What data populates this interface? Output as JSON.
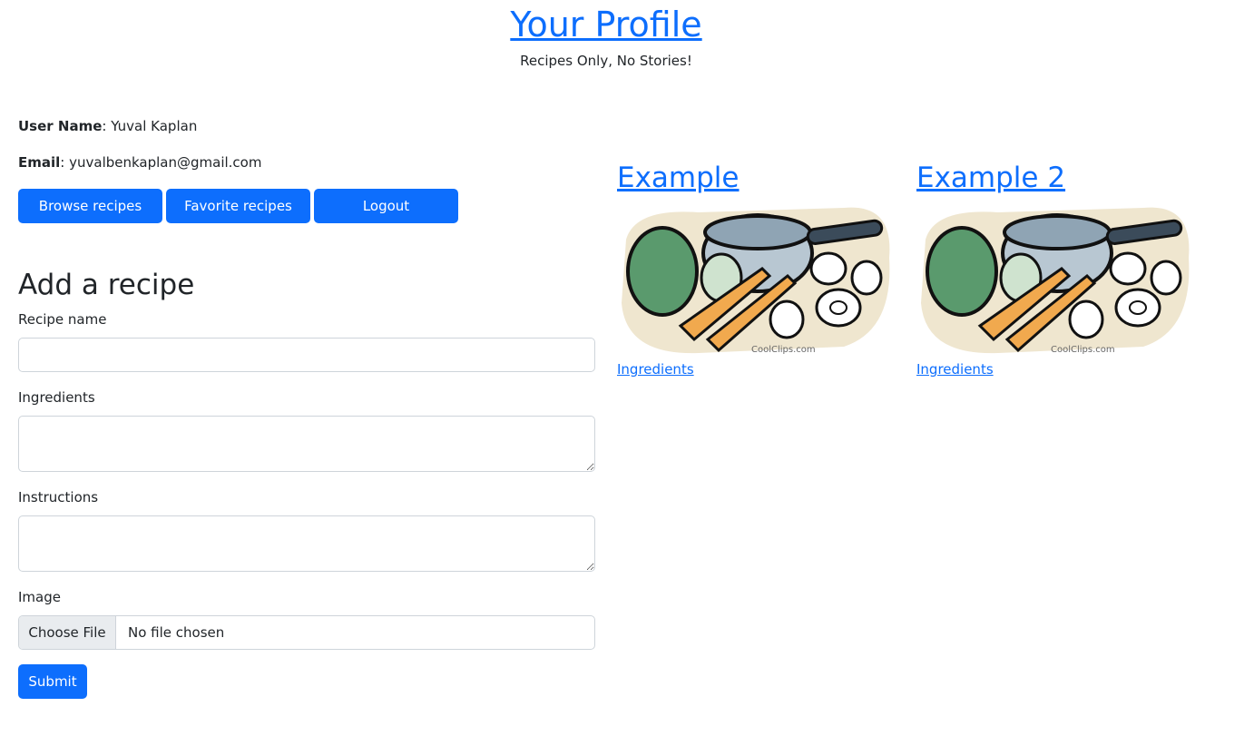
{
  "header": {
    "title": "Your Profile",
    "subtitle": "Recipes Only, No Stories!"
  },
  "profile": {
    "username_label": "User Name",
    "username_value": "Yuval Kaplan",
    "email_label": "Email",
    "email_value": "yuvalbenkaplan@gmail.com"
  },
  "buttons": {
    "browse": "Browse recipes",
    "favorite": "Favorite recipes",
    "logout": "Logout"
  },
  "form": {
    "heading": "Add a recipe",
    "recipe_name_label": "Recipe name",
    "recipe_name_value": "",
    "ingredients_label": "Ingredients",
    "ingredients_value": "",
    "instructions_label": "Instructions",
    "instructions_value": "",
    "image_label": "Image",
    "file_button": "Choose File",
    "file_status": "No file chosen",
    "submit": "Submit"
  },
  "recipes": [
    {
      "title": "Example",
      "link": "Ingredients",
      "image_watermark": "CoolClips.com"
    },
    {
      "title": "Example 2",
      "link": "Ingredients",
      "image_watermark": "CoolClips.com"
    }
  ],
  "colors": {
    "primary": "#0d6efd",
    "text": "#212529",
    "border": "#ced4da"
  }
}
